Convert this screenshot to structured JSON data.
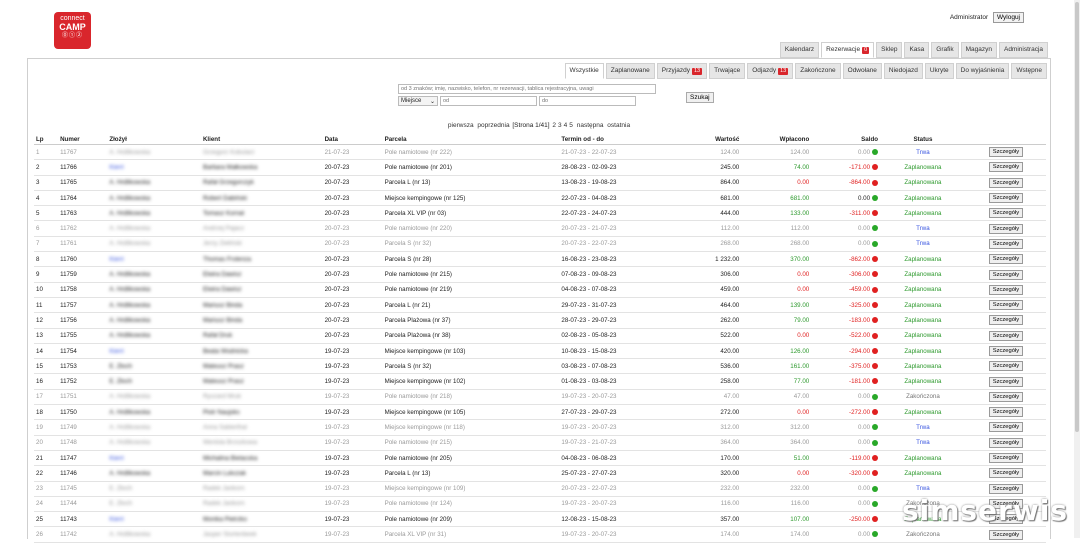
{
  "logo": {
    "line1": "connect",
    "line2": "CAMP",
    "line3": "⓪①②"
  },
  "user": {
    "name": "Administrator",
    "logout": "Wyloguj"
  },
  "mainnav": [
    {
      "label": "Kalendarz",
      "badge": ""
    },
    {
      "label": "Rezerwacje",
      "badge": "0",
      "active": true
    },
    {
      "label": "Sklep",
      "badge": ""
    },
    {
      "label": "Kasa",
      "badge": ""
    },
    {
      "label": "Grafik",
      "badge": ""
    },
    {
      "label": "Magazyn",
      "badge": ""
    },
    {
      "label": "Administracja",
      "badge": ""
    }
  ],
  "subnav": [
    {
      "label": "Wszystkie",
      "badge": "",
      "active": true
    },
    {
      "label": "Zaplanowane",
      "badge": ""
    },
    {
      "label": "Przyjazdy",
      "badge": "13"
    },
    {
      "label": "Trwające",
      "badge": ""
    },
    {
      "label": "Odjazdy",
      "badge": "13"
    },
    {
      "label": "Zakończone",
      "badge": ""
    },
    {
      "label": "Odwołane",
      "badge": ""
    },
    {
      "label": "Niedojazd",
      "badge": ""
    },
    {
      "label": "Ukryte",
      "badge": ""
    },
    {
      "label": "Do wyjaśnienia",
      "badge": ""
    },
    {
      "label": "Wstępne",
      "badge": ""
    }
  ],
  "search": {
    "placeholder": "od 3 znaków; imię, nazwisko, telefon, nr rezerwacji, tablica rejestracyjna, uwagi",
    "select": "Miejsce",
    "from_placeholder": "od",
    "to_placeholder": "do",
    "button": "Szukaj"
  },
  "pager": {
    "first": "pierwsza",
    "prev": "poprzednia",
    "info": "[Strona 1/41]",
    "pages": [
      "2",
      "3",
      "4",
      "5"
    ],
    "next": "następna",
    "last": "ostatnia"
  },
  "table": {
    "headers": [
      "Lp",
      "Numer",
      "Złożył",
      "Klient",
      "Data",
      "Parcela",
      "Termin od - do",
      "Wartość",
      "Wpłacono",
      "Saldo",
      "Status",
      ""
    ],
    "detail_label": "Szczegóły",
    "rows": [
      {
        "lp": "1",
        "num": "11767",
        "by": "A. Hrdlikowska",
        "client": "Grzegorz Kobularz",
        "date": "21-07-23",
        "parcel": "Pole namiotowe (nr 222)",
        "term": "21-07-23 - 22-07-23",
        "val": "124.00",
        "paid": "124.00",
        "saldo": "0.00",
        "sc": "g",
        "status": "Trwa",
        "dim": true,
        "byBlue": false
      },
      {
        "lp": "2",
        "num": "11766",
        "by": "Kierri",
        "client": "Barbara Małkowska",
        "date": "20-07-23",
        "parcel": "Pole namiotowe (nr 201)",
        "term": "28-08-23 - 02-09-23",
        "val": "245.00",
        "paid": "74.00",
        "saldo": "-171.00",
        "sc": "r",
        "status": "Zaplanowana",
        "dim": false,
        "byBlue": true
      },
      {
        "lp": "3",
        "num": "11765",
        "by": "A. Hrdlikowska",
        "client": "Rafał Grzegorczyk",
        "date": "20-07-23",
        "parcel": "Parcela L (nr 13)",
        "term": "13-08-23 - 19-08-23",
        "val": "864.00",
        "paid": "0.00",
        "saldo": "-864.00",
        "sc": "r",
        "status": "Zaplanowana",
        "dim": false,
        "byBlue": false
      },
      {
        "lp": "4",
        "num": "11764",
        "by": "A. Hrdlikowska",
        "client": "Robert Dabiński",
        "date": "20-07-23",
        "parcel": "Miejsce kempingowe (nr 125)",
        "term": "22-07-23 - 04-08-23",
        "val": "681.00",
        "paid": "681.00",
        "saldo": "0.00",
        "sc": "g",
        "status": "Zaplanowana",
        "dim": false,
        "byBlue": false
      },
      {
        "lp": "5",
        "num": "11763",
        "by": "A. Hrdlikowska",
        "client": "Tomasz Kornat",
        "date": "20-07-23",
        "parcel": "Parcela XL VIP (nr 03)",
        "term": "22-07-23 - 24-07-23",
        "val": "444.00",
        "paid": "133.00",
        "saldo": "-311.00",
        "sc": "r",
        "status": "Zaplanowana",
        "dim": false,
        "byBlue": false
      },
      {
        "lp": "6",
        "num": "11762",
        "by": "A. Hrdlikowska",
        "client": "Andrzej Pajacz",
        "date": "20-07-23",
        "parcel": "Pole namiotowe (nr 220)",
        "term": "20-07-23 - 21-07-23",
        "val": "112.00",
        "paid": "112.00",
        "saldo": "0.00",
        "sc": "g",
        "status": "Trwa",
        "dim": true,
        "byBlue": false
      },
      {
        "lp": "7",
        "num": "11761",
        "by": "A. Hrdlikowska",
        "client": "Jerzy Zieliński",
        "date": "20-07-23",
        "parcel": "Parcela S (nr 32)",
        "term": "20-07-23 - 22-07-23",
        "val": "268.00",
        "paid": "268.00",
        "saldo": "0.00",
        "sc": "g",
        "status": "Trwa",
        "dim": true,
        "byBlue": false
      },
      {
        "lp": "8",
        "num": "11760",
        "by": "Kierri",
        "client": "Thomas Frolenza",
        "date": "20-07-23",
        "parcel": "Parcela S (nr 28)",
        "term": "16-08-23 - 23-08-23",
        "val": "1 232.00",
        "paid": "370.00",
        "saldo": "-862.00",
        "sc": "r",
        "status": "Zaplanowana",
        "dim": false,
        "byBlue": true
      },
      {
        "lp": "9",
        "num": "11759",
        "by": "A. Hrdlikowska",
        "client": "Elwira Dawisz",
        "date": "20-07-23",
        "parcel": "Pole namiotowe (nr 215)",
        "term": "07-08-23 - 09-08-23",
        "val": "306.00",
        "paid": "0.00",
        "saldo": "-306.00",
        "sc": "r",
        "status": "Zaplanowana",
        "dim": false,
        "byBlue": false
      },
      {
        "lp": "10",
        "num": "11758",
        "by": "A. Hrdlikowska",
        "client": "Elwira Dawisz",
        "date": "20-07-23",
        "parcel": "Pole namiotowe (nr 219)",
        "term": "04-08-23 - 07-08-23",
        "val": "459.00",
        "paid": "0.00",
        "saldo": "-459.00",
        "sc": "r",
        "status": "Zaplanowana",
        "dim": false,
        "byBlue": false
      },
      {
        "lp": "11",
        "num": "11757",
        "by": "A. Hrdlikowska",
        "client": "Mariusz Binda",
        "date": "20-07-23",
        "parcel": "Parcela L (nr 21)",
        "term": "29-07-23 - 31-07-23",
        "val": "464.00",
        "paid": "139.00",
        "saldo": "-325.00",
        "sc": "r",
        "status": "Zaplanowana",
        "dim": false,
        "byBlue": false
      },
      {
        "lp": "12",
        "num": "11756",
        "by": "A. Hrdlikowska",
        "client": "Mariusz Binda",
        "date": "20-07-23",
        "parcel": "Parcela Plażowa (nr 37)",
        "term": "28-07-23 - 29-07-23",
        "val": "262.00",
        "paid": "79.00",
        "saldo": "-183.00",
        "sc": "r",
        "status": "Zaplanowana",
        "dim": false,
        "byBlue": false
      },
      {
        "lp": "13",
        "num": "11755",
        "by": "A. Hrdlikowska",
        "client": "Rafał Druk",
        "date": "20-07-23",
        "parcel": "Parcela Plażowa (nr 38)",
        "term": "02-08-23 - 05-08-23",
        "val": "522.00",
        "paid": "0.00",
        "saldo": "-522.00",
        "sc": "r",
        "status": "Zaplanowana",
        "dim": false,
        "byBlue": false
      },
      {
        "lp": "14",
        "num": "11754",
        "by": "Kierri",
        "client": "Beata Wodnicka",
        "date": "19-07-23",
        "parcel": "Miejsce kempingowe (nr 103)",
        "term": "10-08-23 - 15-08-23",
        "val": "420.00",
        "paid": "126.00",
        "saldo": "-294.00",
        "sc": "r",
        "status": "Zaplanowana",
        "dim": false,
        "byBlue": true
      },
      {
        "lp": "15",
        "num": "11753",
        "by": "E. Złoch",
        "client": "Mateusz Prasz",
        "date": "19-07-23",
        "parcel": "Parcela S (nr 32)",
        "term": "03-08-23 - 07-08-23",
        "val": "536.00",
        "paid": "161.00",
        "saldo": "-375.00",
        "sc": "r",
        "status": "Zaplanowana",
        "dim": false,
        "byBlue": false
      },
      {
        "lp": "16",
        "num": "11752",
        "by": "E. Złoch",
        "client": "Mateusz Prasz",
        "date": "19-07-23",
        "parcel": "Miejsce kempingowe (nr 102)",
        "term": "01-08-23 - 03-08-23",
        "val": "258.00",
        "paid": "77.00",
        "saldo": "-181.00",
        "sc": "r",
        "status": "Zaplanowana",
        "dim": false,
        "byBlue": false
      },
      {
        "lp": "17",
        "num": "11751",
        "by": "A. Hrdlikowska",
        "client": "Ryszard Mruk",
        "date": "19-07-23",
        "parcel": "Pole namiotowe (nr 218)",
        "term": "19-07-23 - 20-07-23",
        "val": "47.00",
        "paid": "47.00",
        "saldo": "0.00",
        "sc": "g",
        "status": "Zakończona",
        "dim": true,
        "byBlue": false
      },
      {
        "lp": "18",
        "num": "11750",
        "by": "A. Hrdlikowska",
        "client": "Piotr Naujoks",
        "date": "19-07-23",
        "parcel": "Miejsce kempingowe (nr 105)",
        "term": "27-07-23 - 29-07-23",
        "val": "272.00",
        "paid": "0.00",
        "saldo": "-272.00",
        "sc": "r",
        "status": "Zaplanowana",
        "dim": false,
        "byBlue": false
      },
      {
        "lp": "19",
        "num": "11749",
        "by": "A. Hrdlikowska",
        "client": "Anna Sabierthal",
        "date": "19-07-23",
        "parcel": "Miejsce kempingowe (nr 118)",
        "term": "19-07-23 - 20-07-23",
        "val": "312.00",
        "paid": "312.00",
        "saldo": "0.00",
        "sc": "g",
        "status": "Trwa",
        "dim": true,
        "byBlue": false
      },
      {
        "lp": "20",
        "num": "11748",
        "by": "A. Hrdlikowska",
        "client": "Wenlola Brzozkowa",
        "date": "19-07-23",
        "parcel": "Pole namiotowe (nr 215)",
        "term": "19-07-23 - 21-07-23",
        "val": "364.00",
        "paid": "364.00",
        "saldo": "0.00",
        "sc": "g",
        "status": "Trwa",
        "dim": true,
        "byBlue": false
      },
      {
        "lp": "21",
        "num": "11747",
        "by": "Kierri",
        "client": "Michalina Bielacska",
        "date": "19-07-23",
        "parcel": "Pole namiotowe (nr 205)",
        "term": "04-08-23 - 06-08-23",
        "val": "170.00",
        "paid": "51.00",
        "saldo": "-119.00",
        "sc": "r",
        "status": "Zaplanowana",
        "dim": false,
        "byBlue": true
      },
      {
        "lp": "22",
        "num": "11746",
        "by": "A. Hrdlikowska",
        "client": "Marcin Lukczak",
        "date": "19-07-23",
        "parcel": "Parcela L (nr 13)",
        "term": "25-07-23 - 27-07-23",
        "val": "320.00",
        "paid": "0.00",
        "saldo": "-320.00",
        "sc": "r",
        "status": "Zaplanowana",
        "dim": false,
        "byBlue": false
      },
      {
        "lp": "23",
        "num": "11745",
        "by": "E. Złoch",
        "client": "Radek Jankorn",
        "date": "19-07-23",
        "parcel": "Miejsce kempingowe (nr 109)",
        "term": "20-07-23 - 22-07-23",
        "val": "232.00",
        "paid": "232.00",
        "saldo": "0.00",
        "sc": "g",
        "status": "Trwa",
        "dim": true,
        "byBlue": false
      },
      {
        "lp": "24",
        "num": "11744",
        "by": "E. Złoch",
        "client": "Radek Jankorn",
        "date": "19-07-23",
        "parcel": "Pole namiotowe (nr 124)",
        "term": "19-07-23 - 20-07-23",
        "val": "116.00",
        "paid": "116.00",
        "saldo": "0.00",
        "sc": "g",
        "status": "Zakończona",
        "dim": true,
        "byBlue": false
      },
      {
        "lp": "25",
        "num": "11743",
        "by": "Kierri",
        "client": "Monika Pietrzko",
        "date": "19-07-23",
        "parcel": "Pole namiotowe (nr 209)",
        "term": "12-08-23 - 15-08-23",
        "val": "357.00",
        "paid": "107.00",
        "saldo": "-250.00",
        "sc": "r",
        "status": "Zaplanowana",
        "dim": false,
        "byBlue": true
      },
      {
        "lp": "26",
        "num": "11742",
        "by": "A. Hrdlikowska",
        "client": "Jasper Stortenbeek",
        "date": "19-07-23",
        "parcel": "Parcela XL VIP (nr 31)",
        "term": "19-07-23 - 20-07-23",
        "val": "174.00",
        "paid": "174.00",
        "saldo": "0.00",
        "sc": "g",
        "status": "Zakończona",
        "dim": true,
        "byBlue": false
      }
    ]
  },
  "watermark": "simserwis",
  "colors": {
    "brand": "#d9262c",
    "green": "#2e9a2e",
    "red": "#e02020",
    "blue": "#3a56e0"
  }
}
